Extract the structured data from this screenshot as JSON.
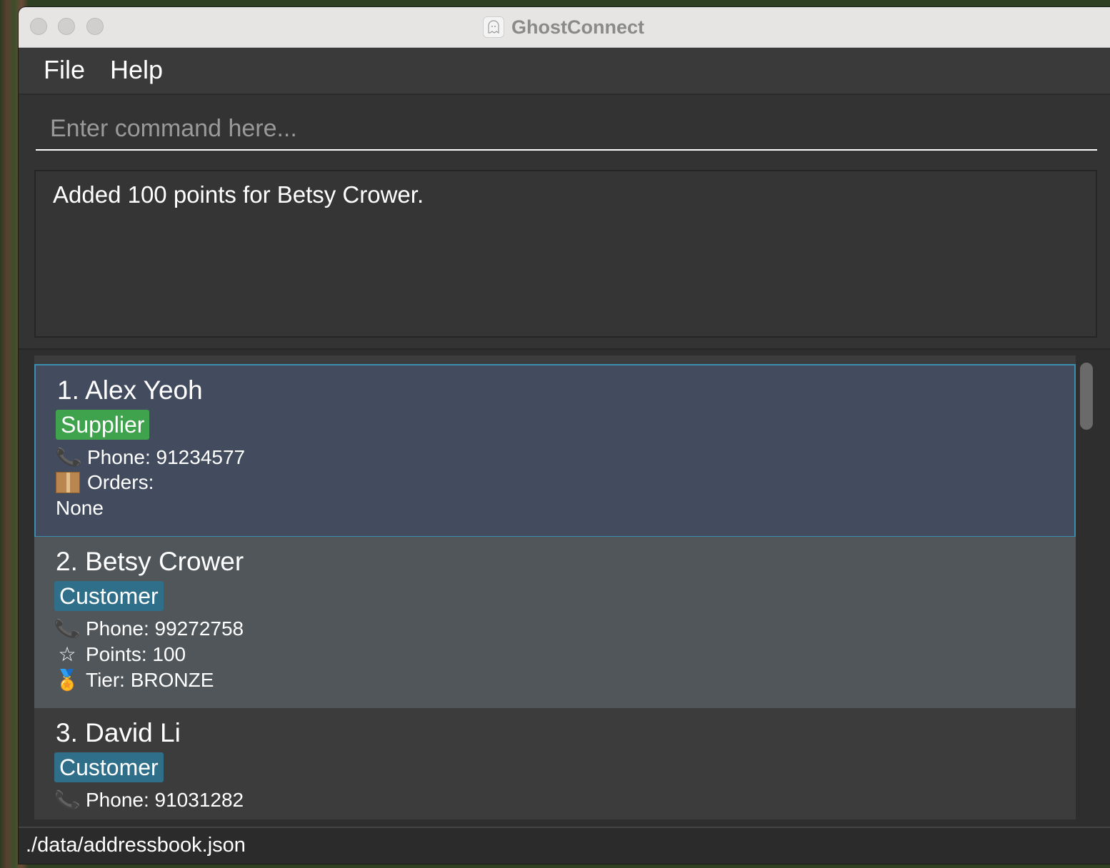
{
  "window": {
    "title": "GhostConnect"
  },
  "menu": {
    "file": "File",
    "help": "Help"
  },
  "command": {
    "placeholder": "Enter command here...",
    "value": ""
  },
  "result": {
    "message": "Added 100 points for Betsy Crower."
  },
  "contacts": [
    {
      "name": "1. Alex Yeoh",
      "tag": "Supplier",
      "phone": "Phone: 91234577",
      "orders_label": "Orders:",
      "orders_value": "None"
    },
    {
      "name": "2. Betsy Crower",
      "tag": "Customer",
      "phone": "Phone: 99272758",
      "points": "Points: 100",
      "tier": "Tier: BRONZE"
    },
    {
      "name": "3. David Li",
      "tag": "Customer",
      "phone": "Phone: 91031282"
    }
  ],
  "status": {
    "file_path": "./data/addressbook.json"
  },
  "icons": {
    "phone": "phone-icon",
    "orders": "package-icon",
    "points": "star-icon",
    "tier": "medal-icon"
  },
  "colors": {
    "supplier_tag": "#3fa34d",
    "customer_tag": "#2f6f8a",
    "selected_card": "#424c5e",
    "selected_border": "#3a8fb0"
  }
}
